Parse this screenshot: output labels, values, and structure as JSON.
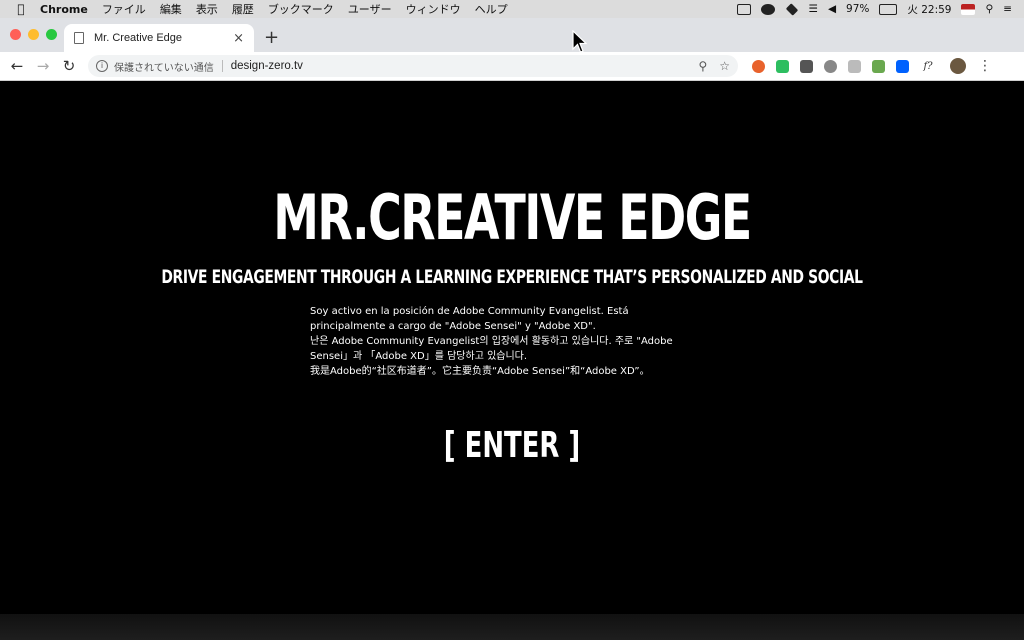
{
  "menubar": {
    "app_name": "Chrome",
    "menus": [
      "ファイル",
      "編集",
      "表示",
      "履歴",
      "ブックマーク",
      "ユーザー",
      "ウィンドウ",
      "ヘルプ"
    ],
    "battery": "97%",
    "clock": "火 22:59"
  },
  "tab": {
    "title": "Mr. Creative Edge",
    "close_symbol": "×",
    "new_tab_symbol": "+"
  },
  "toolbar": {
    "security_label": "保護されていない通信",
    "url": "design-zero.tv"
  },
  "page": {
    "title": "MR.CREATIVE EDGE",
    "subtitle": "DRIVE ENGAGEMENT THROUGH A LEARNING EXPERIENCE THAT’S PERSONALIZED AND SOCIAL",
    "intro_lines": [
      "Soy activo en la posición de Adobe Community Evangelist. Está",
      "principalmente a cargo de \"Adobe Sensei\" y \"Adobe XD\".",
      "난은 Adobe Community Evangelist의 입장에서 활동하고 있습니다. 주로 \"Adobe",
      "Sensei」과 「Adobe XD」를 담당하고 있습니다.",
      "我是Adobe的“社区布道者”。它主要负责“Adobe Sensei”和“Adobe XD”。"
    ],
    "enter_label": "[ ENTER ]"
  },
  "colors": {
    "background": "#000000",
    "text": "#ffffff",
    "tab_strip": "#dfe1e5"
  }
}
